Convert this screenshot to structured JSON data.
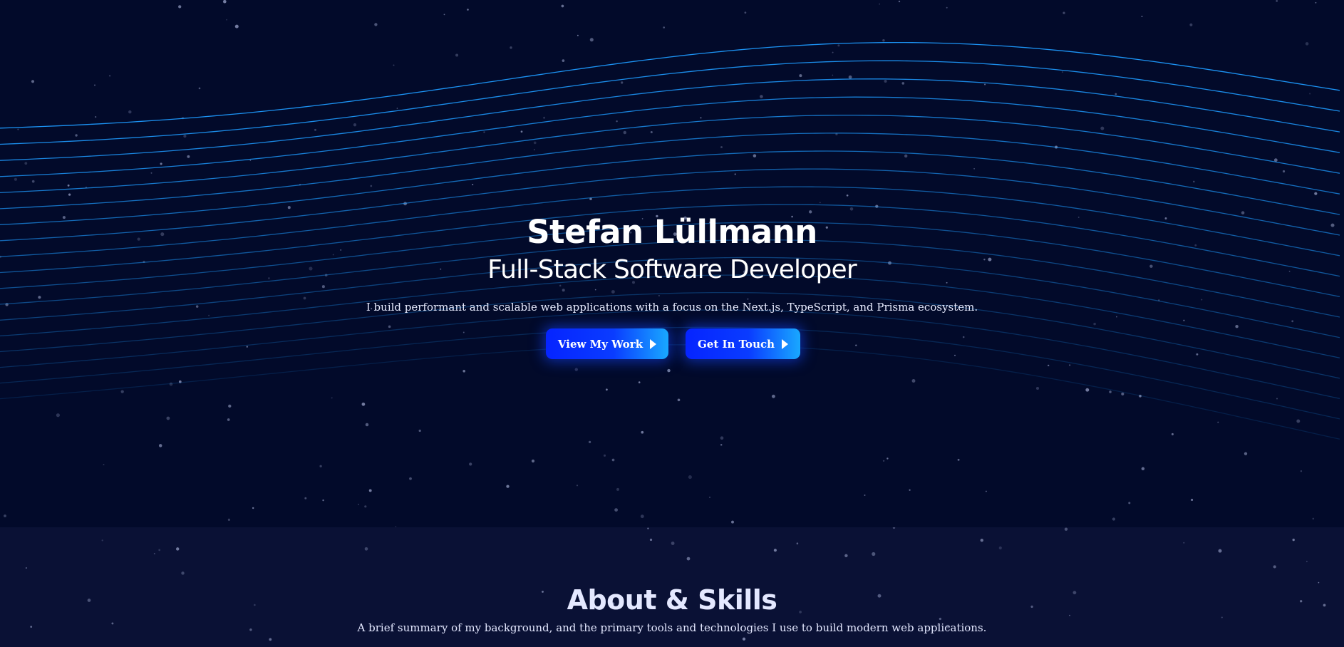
{
  "hero": {
    "name": "Stefan Lüllmann",
    "role": "Full-Stack Software Developer",
    "tagline": "I build performant and scalable web applications with a focus on the Next.js, TypeScript, and Prisma ecosystem.",
    "buttons": [
      {
        "label": "View My Work",
        "icon": "play-arrow-icon"
      },
      {
        "label": "Get In Touch",
        "icon": "play-arrow-icon"
      }
    ]
  },
  "about": {
    "title": "About & Skills",
    "subtitle": "A brief summary of my background, and the primary tools and technologies I use to build modern web applications."
  },
  "colors": {
    "background": "#020a2a",
    "section_background": "#0a1135",
    "wave_line": "#1e9bff",
    "button_start": "#0624ff",
    "button_end": "#19a8ff"
  }
}
